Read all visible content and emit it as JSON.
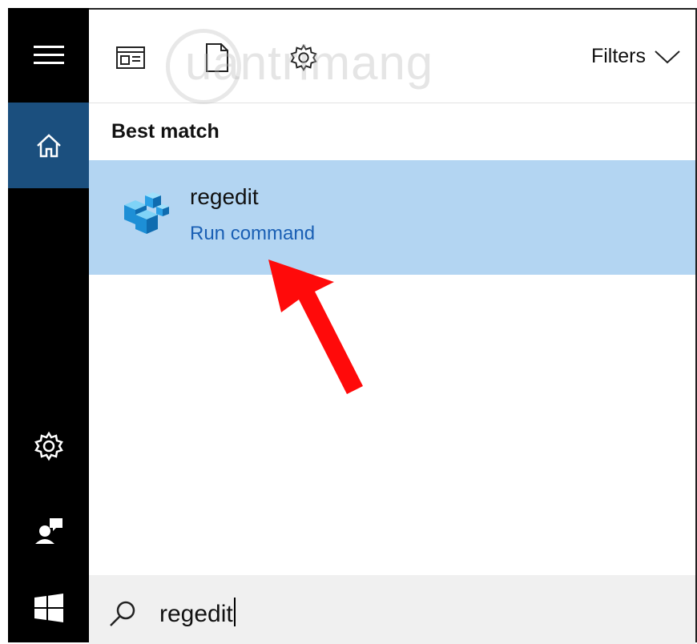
{
  "toolbar": {
    "filters_label": "Filters",
    "icons": [
      "apps-icon",
      "documents-icon",
      "settings-icon"
    ]
  },
  "watermark": "uantrimang",
  "best_match": {
    "title": "Best match",
    "result_name": "regedit",
    "result_type": "Run command",
    "highlight_color": "#b3d5f2",
    "link_color": "#1a5fb4"
  },
  "search": {
    "query": "regedit"
  },
  "rail": {
    "active_color": "#1b4f7e",
    "icons": [
      "hamburger-menu-icon",
      "home-icon",
      "settings-icon",
      "feedback-icon",
      "windows-start-icon"
    ]
  }
}
